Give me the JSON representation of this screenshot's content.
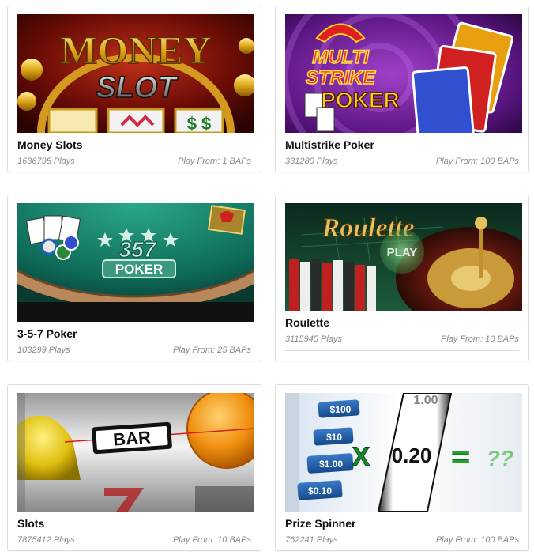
{
  "games": [
    {
      "title": "Money Slots",
      "plays": "1636795 Plays",
      "play_from": "Play From: 1 BAPs",
      "art_text": [
        "MONEY",
        "SLOT"
      ]
    },
    {
      "title": "Multistrike Poker",
      "plays": "331280 Plays",
      "play_from": "Play From: 100 BAPs",
      "art_text": [
        "MULTI",
        "STRIKE",
        "POKER"
      ]
    },
    {
      "title": "3-5-7 Poker",
      "plays": "103299 Plays",
      "play_from": "Play From: 25 BAPs",
      "art_text": [
        "357",
        "POKER"
      ]
    },
    {
      "title": "Roulette",
      "plays": "3115945 Plays",
      "play_from": "Play From: 10 BAPs",
      "art_text": [
        "Roulette",
        "PLAY"
      ]
    },
    {
      "title": "Slots",
      "plays": "7875412 Plays",
      "play_from": "Play From: 10 BAPs",
      "art_text": [
        "BAR"
      ]
    },
    {
      "title": "Prize Spinner",
      "plays": "762241 Plays",
      "play_from": "Play From: 100 BAPs",
      "art_text": [
        "$100",
        "$10",
        "$1.00",
        "$0.10",
        "X",
        "0.20",
        "="
      ]
    }
  ]
}
